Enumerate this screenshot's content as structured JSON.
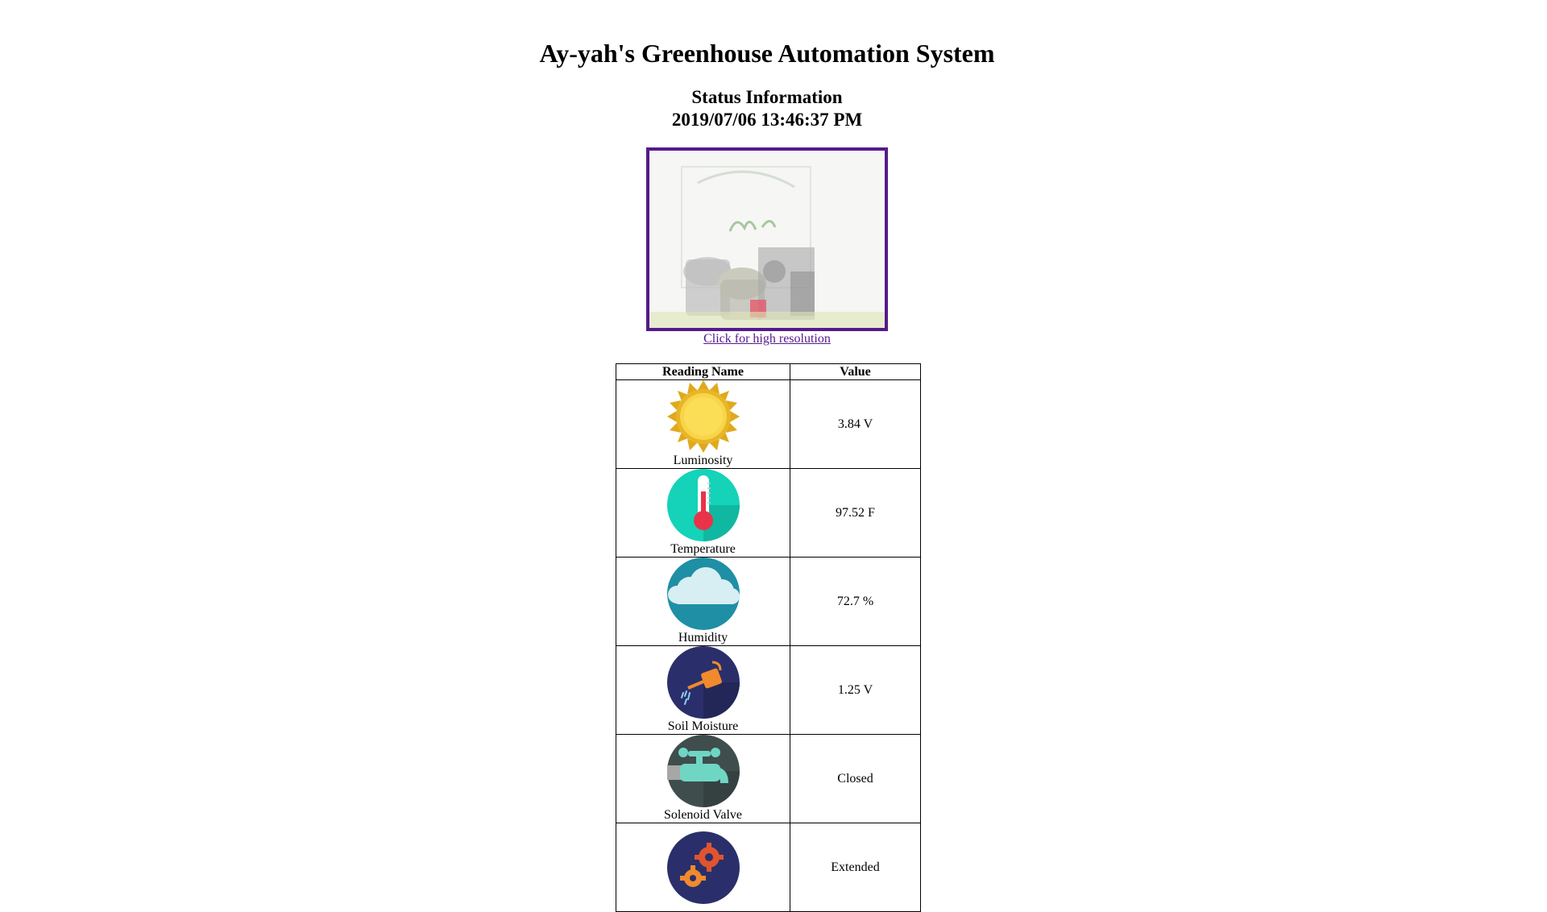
{
  "page": {
    "title": "Ay-yah's Greenhouse Automation System",
    "status_heading": "Status Information",
    "timestamp": "2019/07/06 13:46:37 PM"
  },
  "camera": {
    "link_text": "Click for high resolution",
    "frame_color": "#551a8b"
  },
  "table": {
    "headers": [
      "Reading Name",
      "Value"
    ],
    "rows": [
      {
        "name": "Luminosity",
        "value": "3.84 V",
        "icon": "sun-icon"
      },
      {
        "name": "Temperature",
        "value": "97.52 F",
        "icon": "thermometer-icon"
      },
      {
        "name": "Humidity",
        "value": "72.7 %",
        "icon": "rain-cloud-icon"
      },
      {
        "name": "Soil Moisture",
        "value": "1.25 V",
        "icon": "watering-can-icon"
      },
      {
        "name": "Solenoid Valve",
        "value": "Closed",
        "icon": "faucet-icon"
      },
      {
        "name": "",
        "value": "Extended",
        "icon": "gears-icon"
      }
    ]
  },
  "colors": {
    "link": "#551a8b",
    "sun": "#f2c230",
    "thermometer_bg": "#14d3b9",
    "humidity_bg": "#1f8fa5",
    "soil_bg": "#2a2f6b",
    "valve_bg": "#3f4d4d",
    "gears_bg": "#2a2f6b"
  }
}
